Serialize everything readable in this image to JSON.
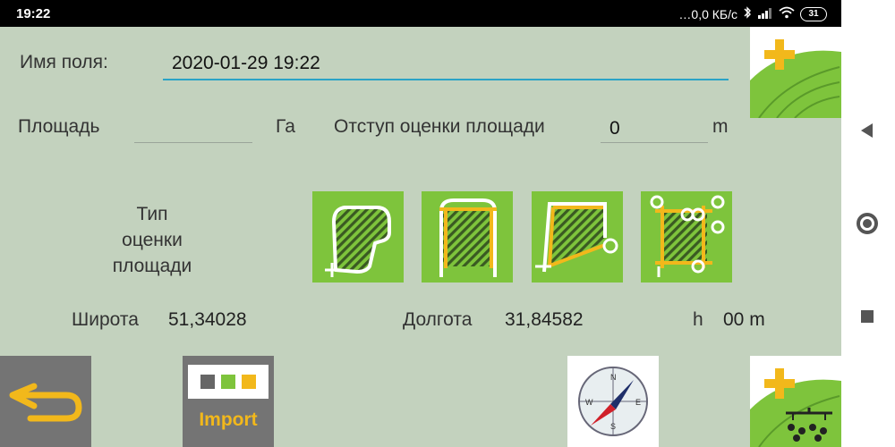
{
  "status_bar": {
    "time": "19:22",
    "network_speed": "…0,0 КБ/с",
    "battery": "31"
  },
  "form": {
    "field_name_label": "Имя поля:",
    "field_name_value": "2020-01-29 19:22",
    "area_label": "Площадь",
    "area_value": "",
    "area_unit": "Га",
    "offset_label": "Отступ оценки площади",
    "offset_value": "0",
    "offset_unit": "m"
  },
  "measure_type": {
    "label_lines": [
      "Тип",
      "оценки",
      "площади"
    ],
    "buttons": [
      "freehand-perimeter",
      "edges-by-points",
      "boundary-with-corner",
      "corner-points"
    ]
  },
  "coords": {
    "lat_label": "Широта",
    "lat_value": "51,34028",
    "lon_label": "Долгота",
    "lon_value": "31,84582",
    "height_label": "h",
    "height_value": "00 m"
  },
  "bottom_bar": {
    "import_label": "Import"
  },
  "compass_letters": [
    "N",
    "E",
    "S",
    "W"
  ],
  "colors": {
    "background": "#c3d2be",
    "accent_green": "#7ec43c",
    "accent_orange": "#f2b81b",
    "input_underline": "#2ba3c6"
  }
}
